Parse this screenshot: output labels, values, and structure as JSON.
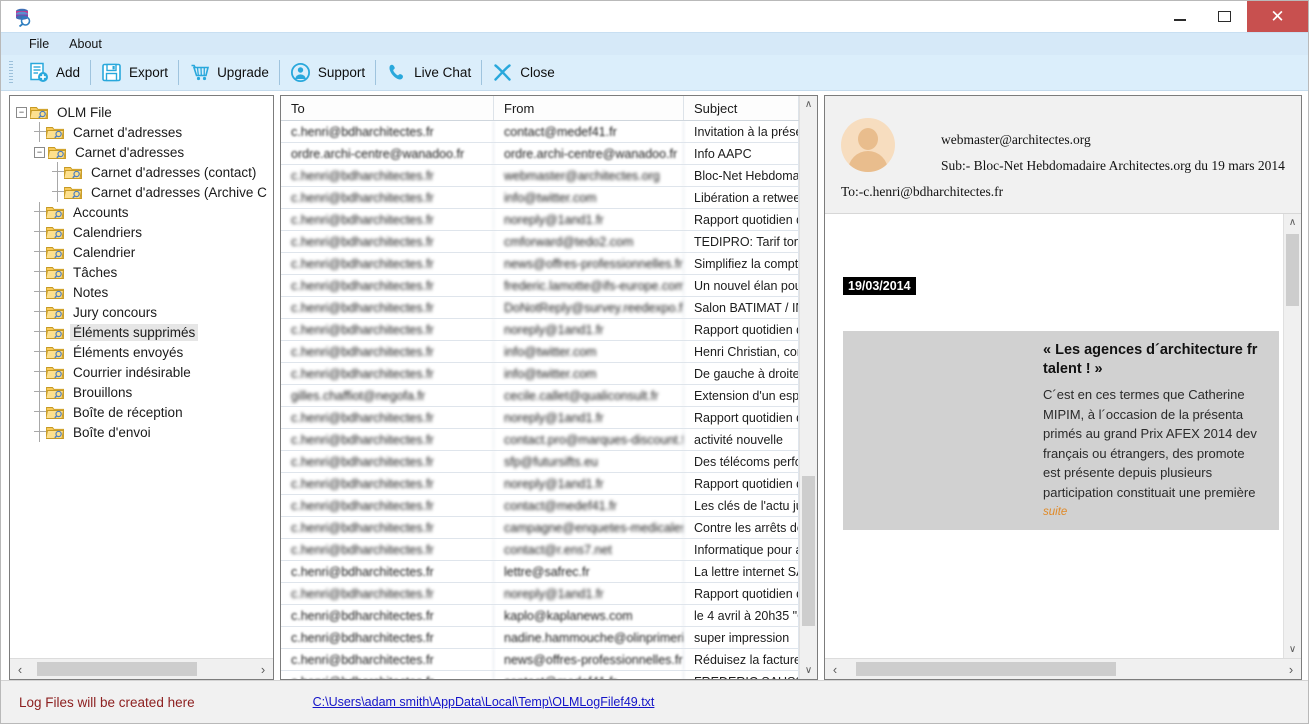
{
  "window": {
    "app_icon": "olm-converter-icon",
    "minimize_label": "–",
    "maximize_label": "",
    "close_label": "✕"
  },
  "menubar": {
    "items": [
      {
        "label": "File",
        "name": "menu-file"
      },
      {
        "label": "About",
        "name": "menu-about"
      }
    ]
  },
  "toolbar": {
    "buttons": [
      {
        "label": "Add",
        "icon": "add-file-icon"
      },
      {
        "label": "Export",
        "icon": "save-floppy-icon"
      },
      {
        "label": "Upgrade",
        "icon": "shopping-cart-icon"
      },
      {
        "label": "Support",
        "icon": "user-circle-icon"
      },
      {
        "label": "Live Chat",
        "icon": "phone-icon"
      },
      {
        "label": "Close",
        "icon": "close-x-icon"
      }
    ]
  },
  "tree": {
    "nodes": [
      {
        "label": "OLM File",
        "depth": 0,
        "twist": "−",
        "selected": false
      },
      {
        "label": "Carnet d'adresses",
        "depth": 1,
        "twist": "",
        "selected": false
      },
      {
        "label": "Carnet d'adresses",
        "depth": 1,
        "twist": "−",
        "selected": false
      },
      {
        "label": "Carnet d'adresses  (contact)",
        "depth": 2,
        "twist": "",
        "selected": false
      },
      {
        "label": "Carnet d'adresses  (Archive C",
        "depth": 2,
        "twist": "",
        "selected": false
      },
      {
        "label": "Accounts",
        "depth": 1,
        "twist": "",
        "selected": false
      },
      {
        "label": "Calendriers",
        "depth": 1,
        "twist": "",
        "selected": false
      },
      {
        "label": "Calendrier",
        "depth": 1,
        "twist": "",
        "selected": false
      },
      {
        "label": "Tâches",
        "depth": 1,
        "twist": "",
        "selected": false
      },
      {
        "label": "Notes",
        "depth": 1,
        "twist": "",
        "selected": false
      },
      {
        "label": "Jury concours",
        "depth": 1,
        "twist": "",
        "selected": false
      },
      {
        "label": "Éléments supprimés",
        "depth": 1,
        "twist": "",
        "selected": true
      },
      {
        "label": "Éléments envoyés",
        "depth": 1,
        "twist": "",
        "selected": false
      },
      {
        "label": "Courrier indésirable",
        "depth": 1,
        "twist": "",
        "selected": false
      },
      {
        "label": "Brouillons",
        "depth": 1,
        "twist": "",
        "selected": false
      },
      {
        "label": "Boîte de réception",
        "depth": 1,
        "twist": "",
        "selected": false
      },
      {
        "label": "Boîte d'envoi",
        "depth": 1,
        "twist": "",
        "selected": false
      }
    ],
    "hscroll": {
      "left_arrow": "‹",
      "right_arrow": "›"
    }
  },
  "maillist": {
    "columns": [
      "To",
      "From",
      "Subject"
    ],
    "vscroll": {
      "up_arrow": "∧",
      "down_arrow": "∨"
    },
    "rows": [
      {
        "to": "c.henri@bdharchitectes.fr",
        "from": "contact@medef41.fr",
        "subject": "Invitation à la présentation",
        "blur": 1
      },
      {
        "to": "ordre.archi-centre@wanadoo.fr",
        "from": "ordre.archi-centre@wanadoo.fr",
        "subject": "Info AAPC",
        "blur": 1
      },
      {
        "to": "c.henri@bdharchitectes.fr",
        "from": "webmaster@architectes.org",
        "subject": "Bloc-Net Hebdomadaire A",
        "blur": 2
      },
      {
        "to": "c.henri@bdharchitectes.fr",
        "from": "info@twitter.com",
        "subject": "Libération a retweeté un T",
        "blur": 2
      },
      {
        "to": "c.henri@bdharchitectes.fr",
        "from": "noreply@1and1.fr",
        "subject": "Rapport quotidien du doss",
        "blur": 2
      },
      {
        "to": "c.henri@bdharchitectes.fr",
        "from": "cmforward@tedo2.com",
        "subject": "TEDIPRO: Tarif toners co",
        "blur": 2
      },
      {
        "to": "c.henri@bdharchitectes.fr",
        "from": "news@offres-professionnelles.fr",
        "subject": "Simplifiez la comptabilité d",
        "blur": 2
      },
      {
        "to": "c.henri@bdharchitectes.fr",
        "from": "frederic.lamotte@ifs-europe.com",
        "subject": "Un nouvel élan pour l'enga",
        "blur": 2
      },
      {
        "to": "c.henri@bdharchitectes.fr",
        "from": "DoNotReply@survey.reedexpo.fr",
        "subject": "Salon BATIMAT / INTERC",
        "blur": 2
      },
      {
        "to": "c.henri@bdharchitectes.fr",
        "from": "noreply@1and1.fr",
        "subject": "Rapport quotidien du doss",
        "blur": 2
      },
      {
        "to": "c.henri@bdharchitectes.fr",
        "from": "info@twitter.com",
        "subject": "Henri Christian, complétez",
        "blur": 2
      },
      {
        "to": "c.henri@bdharchitectes.fr",
        "from": "info@twitter.com",
        "subject": "De gauche à droite, le poi",
        "blur": 2
      },
      {
        "to": "gilles.chaffiot@negofa.fr",
        "from": "cecile.callet@qualiconsult.fr",
        "subject": "Extension d'un espace fon",
        "blur": 2
      },
      {
        "to": "c.henri@bdharchitectes.fr",
        "from": "noreply@1and1.fr",
        "subject": "Rapport quotidien du doss",
        "blur": 2
      },
      {
        "to": "c.henri@bdharchitectes.fr",
        "from": "contact.pro@marques-discount.fr",
        "subject": "activité nouvelle",
        "blur": 2
      },
      {
        "to": "c.henri@bdharchitectes.fr",
        "from": "sfp@futursifts.eu",
        "subject": "Des télécoms performante",
        "blur": 2
      },
      {
        "to": "c.henri@bdharchitectes.fr",
        "from": "noreply@1and1.fr",
        "subject": "Rapport quotidien du doss",
        "blur": 2
      },
      {
        "to": "c.henri@bdharchitectes.fr",
        "from": "contact@medef41.fr",
        "subject": "Les clés de l'actu juridique",
        "blur": 2
      },
      {
        "to": "c.henri@bdharchitectes.fr",
        "from": "campagne@enquetes-medicales.fr",
        "subject": "Contre les arrêts de maladi",
        "blur": 2
      },
      {
        "to": "c.henri@bdharchitectes.fr",
        "from": "contact@r.ens7.net",
        "subject": "Informatique pour architec",
        "blur": 2
      },
      {
        "to": "c.henri@bdharchitectes.fr",
        "from": "lettre@safrec.fr",
        "subject": "La lettre internet SAFREC",
        "blur": 1
      },
      {
        "to": "c.henri@bdharchitectes.fr",
        "from": "noreply@1and1.fr",
        "subject": "Rapport quotidien du doss",
        "blur": 2
      },
      {
        "to": "c.henri@bdharchitectes.fr",
        "from": "kaplo@kaplanews.com",
        "subject": "le 4 avril à 20h35  \"On n'e",
        "blur": 1
      },
      {
        "to": "c.henri@bdharchitectes.fr",
        "from": "nadine.hammouche@olinprimerie.co",
        "subject": "super  impression",
        "blur": 1
      },
      {
        "to": "c.henri@bdharchitectes.fr",
        "from": "news@offres-professionnelles.fr",
        "subject": "Réduisez la facture téléco",
        "blur": 1
      },
      {
        "to": "c.henri@bdharchitectes.fr",
        "from": "contact@medef41.fr",
        "subject": "FREDERIC SAUSSET : U",
        "blur": 1
      }
    ]
  },
  "preview": {
    "from": "webmaster@architectes.org",
    "subject": "Sub:- Bloc-Net Hebdomadaire Architectes.org du 19 mars 2014",
    "to": "To:-c.henri@bdharchitectes.fr",
    "date_badge": "19/03/2014",
    "article_title": "« Les agences d´architecture fr",
    "article_title2": "talent ! »",
    "article_lines": [
      "C´est en ces termes que Catherine",
      "MIPIM, à l´occasion de la présenta",
      "primés au grand Prix AFEX 2014 dev",
      "français ou étrangers, des promote",
      "est  présente  depuis  plusieurs",
      "participation constituait une première"
    ],
    "more_link": "suite",
    "vscroll": {
      "up_arrow": "∧",
      "down_arrow": "∨"
    },
    "hscroll": {
      "left_arrow": "‹",
      "right_arrow": "›"
    }
  },
  "statusbar": {
    "message": "Log Files will be created here",
    "log_path": "C:\\Users\\adam smith\\AppData\\Local\\Temp\\OLMLogFilef49.txt"
  },
  "colors": {
    "accent": "#29a8dc",
    "menu_bg": "#d6e9f8",
    "toolbar_bg": "#dbeefb",
    "close_btn": "#c8504f",
    "status_text": "#8d2020",
    "link": "#1414c8",
    "badge_bg": "#000000",
    "article_bg": "#d1d1d1",
    "more_link": "#e08a28"
  }
}
